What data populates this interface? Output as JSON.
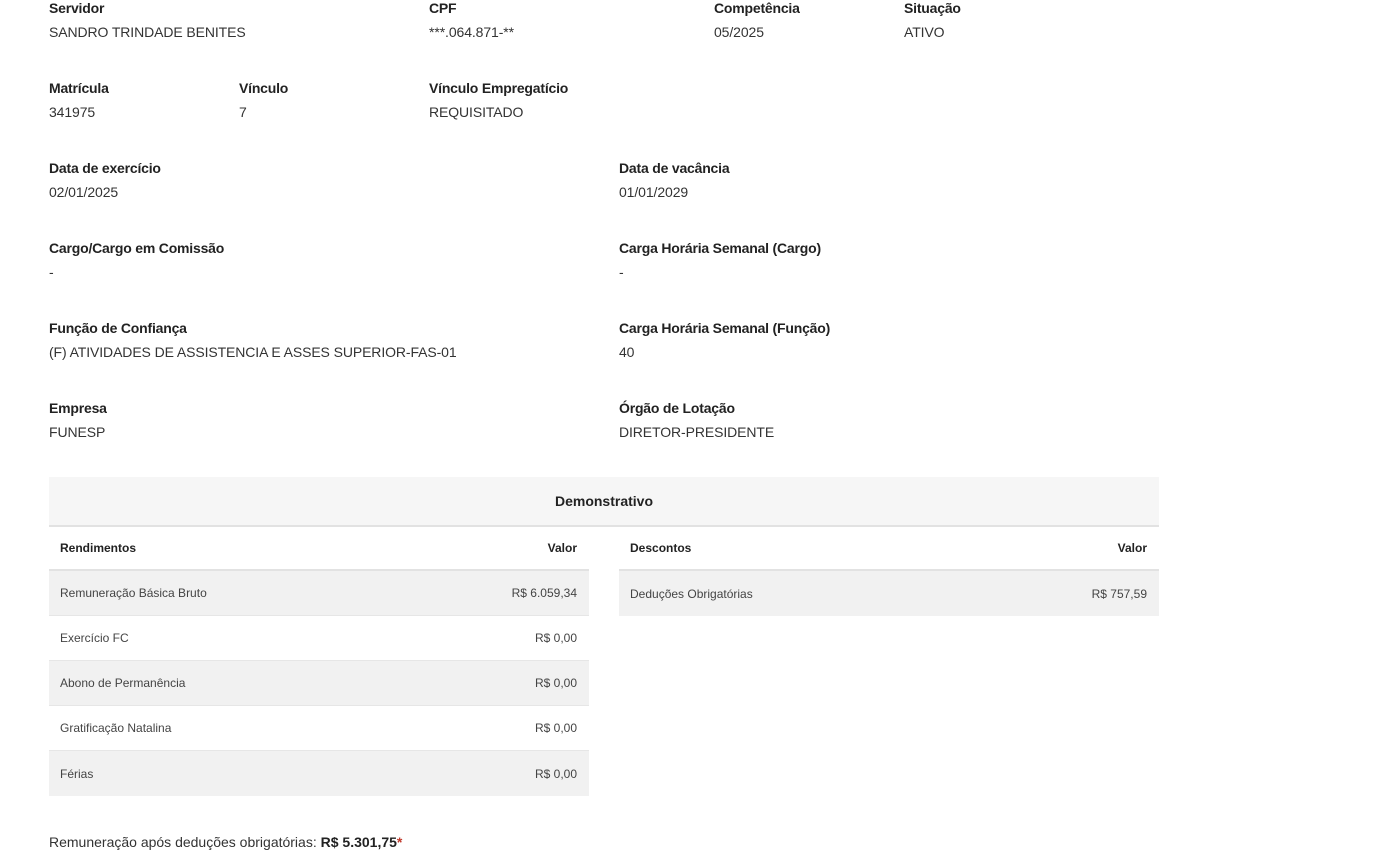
{
  "row1": {
    "servidor": {
      "label": "Servidor",
      "value": "SANDRO TRINDADE BENITES"
    },
    "cpf": {
      "label": "CPF",
      "value": "***.064.871-**"
    },
    "competencia": {
      "label": "Competência",
      "value": "05/2025"
    },
    "situacao": {
      "label": "Situação",
      "value": "ATIVO"
    }
  },
  "row2": {
    "matricula": {
      "label": "Matrícula",
      "value": "341975"
    },
    "vinculo": {
      "label": "Vínculo",
      "value": "7"
    },
    "vinculo_empregaticio": {
      "label": "Vínculo Empregatício",
      "value": "REQUISITADO"
    }
  },
  "row3": {
    "data_exercicio": {
      "label": "Data de exercício",
      "value": "02/01/2025"
    },
    "data_vacancia": {
      "label": "Data de vacância",
      "value": "01/01/2029"
    }
  },
  "row4": {
    "cargo": {
      "label": "Cargo/Cargo em Comissão",
      "value": "-"
    },
    "carga_cargo": {
      "label": "Carga Horária Semanal (Cargo)",
      "value": "-"
    }
  },
  "row5": {
    "funcao": {
      "label": "Função de Confiança",
      "value": "(F) ATIVIDADES DE ASSISTENCIA E ASSES SUPERIOR-FAS-01"
    },
    "carga_funcao": {
      "label": "Carga Horária Semanal (Função)",
      "value": "40"
    }
  },
  "row6": {
    "empresa": {
      "label": "Empresa",
      "value": "FUNESP"
    },
    "orgao": {
      "label": "Órgão de Lotação",
      "value": "DIRETOR-PRESIDENTE"
    }
  },
  "demonstrativo": {
    "title": "Demonstrativo",
    "rendimentos": {
      "header": "Rendimentos",
      "value_header": "Valor",
      "rows": [
        {
          "label": "Remuneração Básica Bruto",
          "value": "R$ 6.059,34"
        },
        {
          "label": "Exercício FC",
          "value": "R$ 0,00"
        },
        {
          "label": "Abono de Permanência",
          "value": "R$ 0,00"
        },
        {
          "label": "Gratificação Natalina",
          "value": "R$ 0,00"
        },
        {
          "label": "Férias",
          "value": "R$ 0,00"
        }
      ]
    },
    "descontos": {
      "header": "Descontos",
      "value_header": "Valor",
      "rows": [
        {
          "label": "Deduções Obrigatórias",
          "value": "R$ 757,59"
        }
      ]
    }
  },
  "summary": {
    "label": "Remuneração após deduções obrigatórias:",
    "amount": "R$ 5.301,75",
    "asterisk": "*"
  }
}
